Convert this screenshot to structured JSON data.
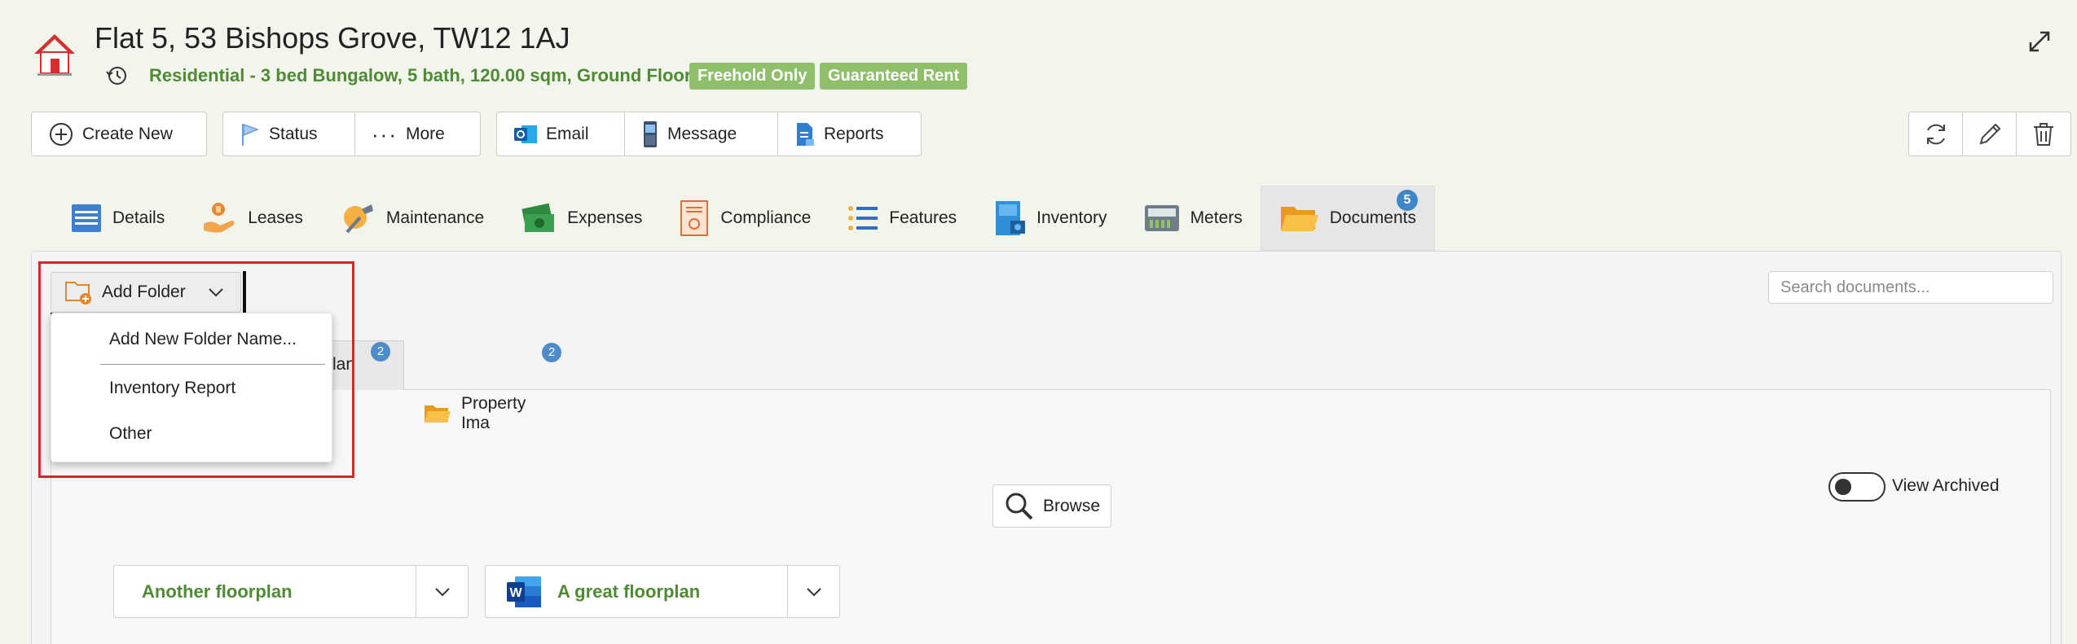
{
  "header": {
    "title": "Flat 5,  53 Bishops Grove, TW12 1AJ",
    "subtitle": "Residential - 3 bed Bungalow, 5 bath, 120.00 sqm, Ground Floor",
    "badges": [
      "Freehold Only",
      "Guaranteed Rent"
    ],
    "accent_color": "#4f8a34",
    "badge_color": "#8fbf6a"
  },
  "toolbar": {
    "create_new": "Create New",
    "status": "Status",
    "more": "More",
    "email": "Email",
    "message": "Message",
    "reports": "Reports"
  },
  "tabs": [
    {
      "label": "Details",
      "icon": "details-icon"
    },
    {
      "label": "Leases",
      "icon": "leases-icon"
    },
    {
      "label": "Maintenance",
      "icon": "maintenance-icon"
    },
    {
      "label": "Expenses",
      "icon": "expenses-icon"
    },
    {
      "label": "Compliance",
      "icon": "compliance-icon"
    },
    {
      "label": "Features",
      "icon": "features-icon"
    },
    {
      "label": "Inventory",
      "icon": "inventory-icon"
    },
    {
      "label": "Meters",
      "icon": "meters-icon"
    },
    {
      "label": "Documents",
      "icon": "folder-icon",
      "count": "5",
      "active": true
    }
  ],
  "documents": {
    "add_folder": "Add Folder",
    "search_placeholder": "Search documents...",
    "dropdown": {
      "add_new": "Add New Folder Name...",
      "items": [
        "Inventory Report",
        "Other"
      ]
    },
    "subtabs": [
      {
        "label": "lan",
        "count": "2"
      },
      {
        "label": "Property Ima",
        "count": "2"
      }
    ],
    "view_archived": "View Archived",
    "browse": "Browse",
    "files": [
      {
        "name": "Another floorplan",
        "icon": ""
      },
      {
        "name": "A great floorplan",
        "icon": "word-icon"
      }
    ]
  }
}
